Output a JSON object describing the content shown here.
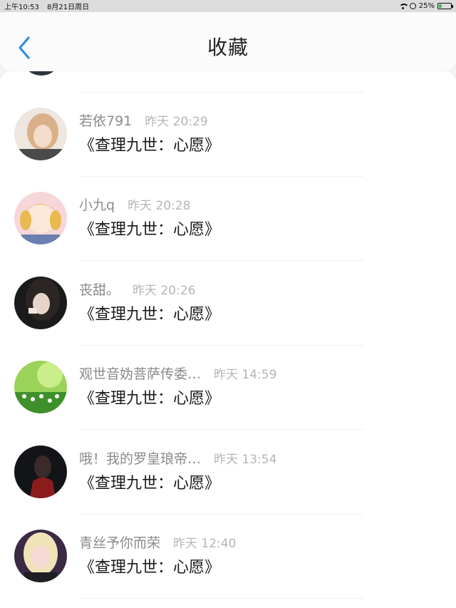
{
  "status_bar": {
    "time": "上午10:53",
    "date": "8月21日周日",
    "battery_percent": "25%",
    "battery_level": 0.25,
    "colors": {
      "battery": "#2ec24a"
    }
  },
  "header": {
    "title": "收藏",
    "back_icon": "chevron-left-icon",
    "accent": "#2e8fe0"
  },
  "favorites": [
    {
      "user": "若依791",
      "time": "昨天 20:29",
      "title": "《查理九世：心愿》"
    },
    {
      "user": "小九q",
      "time": "昨天 20:28",
      "title": "《查理九世：心愿》"
    },
    {
      "user": "丧甜。",
      "time": "昨天 20:26",
      "title": "《查理九世：心愿》"
    },
    {
      "user": "观世音妫菩萨传委…",
      "time": "昨天 14:59",
      "title": "《查理九世：心愿》"
    },
    {
      "user": "哦！我的罗皇琅帝…",
      "time": "昨天 13:54",
      "title": "《查理九世：心愿》"
    },
    {
      "user": "青丝予你而荣",
      "time": "昨天 12:40",
      "title": "《查理九世：心愿》"
    }
  ]
}
